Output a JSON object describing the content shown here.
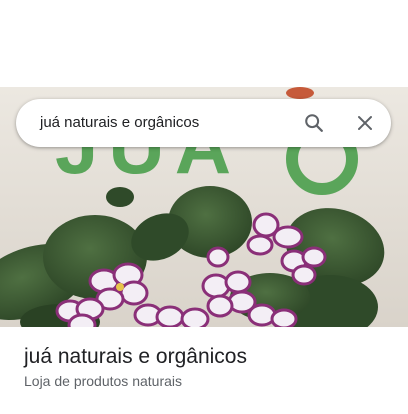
{
  "search": {
    "query": "juá naturais e orgânicos",
    "search_icon": "search-icon",
    "close_icon": "close-icon"
  },
  "photo": {
    "sign_text": "JUÁ"
  },
  "place": {
    "name": "juá naturais e orgânicos",
    "category": "Loja de produtos naturais"
  },
  "colors": {
    "wall": "#e4dfd7",
    "sign_green": "#5aa55a",
    "leaf": "#3d5b34",
    "petal_white": "#f3eef5",
    "petal_purple": "#8a2f78",
    "text_primary": "#202124",
    "text_secondary": "#5f6368",
    "icon": "#5f6368"
  }
}
